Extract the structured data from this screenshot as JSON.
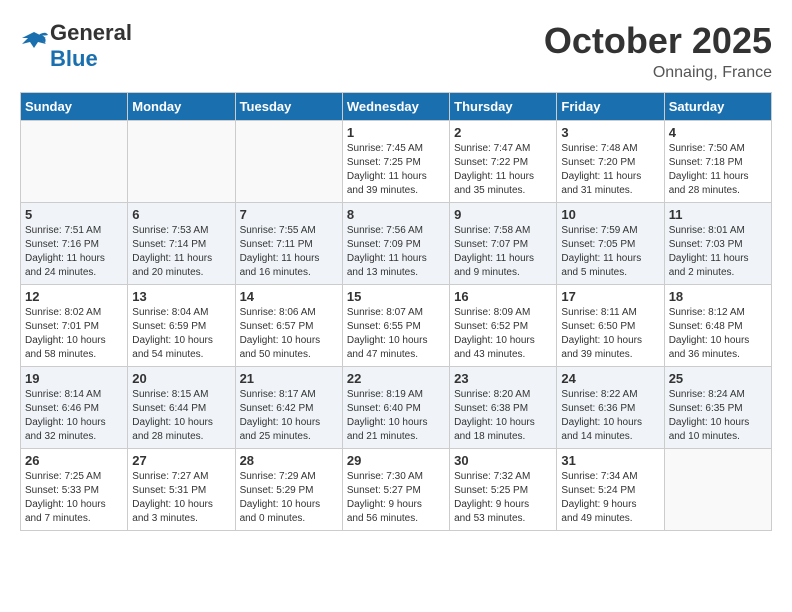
{
  "header": {
    "logo_general": "General",
    "logo_blue": "Blue",
    "month_title": "October 2025",
    "location": "Onnaing, France"
  },
  "weekdays": [
    "Sunday",
    "Monday",
    "Tuesday",
    "Wednesday",
    "Thursday",
    "Friday",
    "Saturday"
  ],
  "weeks": [
    [
      {
        "day": "",
        "info": ""
      },
      {
        "day": "",
        "info": ""
      },
      {
        "day": "",
        "info": ""
      },
      {
        "day": "1",
        "info": "Sunrise: 7:45 AM\nSunset: 7:25 PM\nDaylight: 11 hours\nand 39 minutes."
      },
      {
        "day": "2",
        "info": "Sunrise: 7:47 AM\nSunset: 7:22 PM\nDaylight: 11 hours\nand 35 minutes."
      },
      {
        "day": "3",
        "info": "Sunrise: 7:48 AM\nSunset: 7:20 PM\nDaylight: 11 hours\nand 31 minutes."
      },
      {
        "day": "4",
        "info": "Sunrise: 7:50 AM\nSunset: 7:18 PM\nDaylight: 11 hours\nand 28 minutes."
      }
    ],
    [
      {
        "day": "5",
        "info": "Sunrise: 7:51 AM\nSunset: 7:16 PM\nDaylight: 11 hours\nand 24 minutes."
      },
      {
        "day": "6",
        "info": "Sunrise: 7:53 AM\nSunset: 7:14 PM\nDaylight: 11 hours\nand 20 minutes."
      },
      {
        "day": "7",
        "info": "Sunrise: 7:55 AM\nSunset: 7:11 PM\nDaylight: 11 hours\nand 16 minutes."
      },
      {
        "day": "8",
        "info": "Sunrise: 7:56 AM\nSunset: 7:09 PM\nDaylight: 11 hours\nand 13 minutes."
      },
      {
        "day": "9",
        "info": "Sunrise: 7:58 AM\nSunset: 7:07 PM\nDaylight: 11 hours\nand 9 minutes."
      },
      {
        "day": "10",
        "info": "Sunrise: 7:59 AM\nSunset: 7:05 PM\nDaylight: 11 hours\nand 5 minutes."
      },
      {
        "day": "11",
        "info": "Sunrise: 8:01 AM\nSunset: 7:03 PM\nDaylight: 11 hours\nand 2 minutes."
      }
    ],
    [
      {
        "day": "12",
        "info": "Sunrise: 8:02 AM\nSunset: 7:01 PM\nDaylight: 10 hours\nand 58 minutes."
      },
      {
        "day": "13",
        "info": "Sunrise: 8:04 AM\nSunset: 6:59 PM\nDaylight: 10 hours\nand 54 minutes."
      },
      {
        "day": "14",
        "info": "Sunrise: 8:06 AM\nSunset: 6:57 PM\nDaylight: 10 hours\nand 50 minutes."
      },
      {
        "day": "15",
        "info": "Sunrise: 8:07 AM\nSunset: 6:55 PM\nDaylight: 10 hours\nand 47 minutes."
      },
      {
        "day": "16",
        "info": "Sunrise: 8:09 AM\nSunset: 6:52 PM\nDaylight: 10 hours\nand 43 minutes."
      },
      {
        "day": "17",
        "info": "Sunrise: 8:11 AM\nSunset: 6:50 PM\nDaylight: 10 hours\nand 39 minutes."
      },
      {
        "day": "18",
        "info": "Sunrise: 8:12 AM\nSunset: 6:48 PM\nDaylight: 10 hours\nand 36 minutes."
      }
    ],
    [
      {
        "day": "19",
        "info": "Sunrise: 8:14 AM\nSunset: 6:46 PM\nDaylight: 10 hours\nand 32 minutes."
      },
      {
        "day": "20",
        "info": "Sunrise: 8:15 AM\nSunset: 6:44 PM\nDaylight: 10 hours\nand 28 minutes."
      },
      {
        "day": "21",
        "info": "Sunrise: 8:17 AM\nSunset: 6:42 PM\nDaylight: 10 hours\nand 25 minutes."
      },
      {
        "day": "22",
        "info": "Sunrise: 8:19 AM\nSunset: 6:40 PM\nDaylight: 10 hours\nand 21 minutes."
      },
      {
        "day": "23",
        "info": "Sunrise: 8:20 AM\nSunset: 6:38 PM\nDaylight: 10 hours\nand 18 minutes."
      },
      {
        "day": "24",
        "info": "Sunrise: 8:22 AM\nSunset: 6:36 PM\nDaylight: 10 hours\nand 14 minutes."
      },
      {
        "day": "25",
        "info": "Sunrise: 8:24 AM\nSunset: 6:35 PM\nDaylight: 10 hours\nand 10 minutes."
      }
    ],
    [
      {
        "day": "26",
        "info": "Sunrise: 7:25 AM\nSunset: 5:33 PM\nDaylight: 10 hours\nand 7 minutes."
      },
      {
        "day": "27",
        "info": "Sunrise: 7:27 AM\nSunset: 5:31 PM\nDaylight: 10 hours\nand 3 minutes."
      },
      {
        "day": "28",
        "info": "Sunrise: 7:29 AM\nSunset: 5:29 PM\nDaylight: 10 hours\nand 0 minutes."
      },
      {
        "day": "29",
        "info": "Sunrise: 7:30 AM\nSunset: 5:27 PM\nDaylight: 9 hours\nand 56 minutes."
      },
      {
        "day": "30",
        "info": "Sunrise: 7:32 AM\nSunset: 5:25 PM\nDaylight: 9 hours\nand 53 minutes."
      },
      {
        "day": "31",
        "info": "Sunrise: 7:34 AM\nSunset: 5:24 PM\nDaylight: 9 hours\nand 49 minutes."
      },
      {
        "day": "",
        "info": ""
      }
    ]
  ]
}
